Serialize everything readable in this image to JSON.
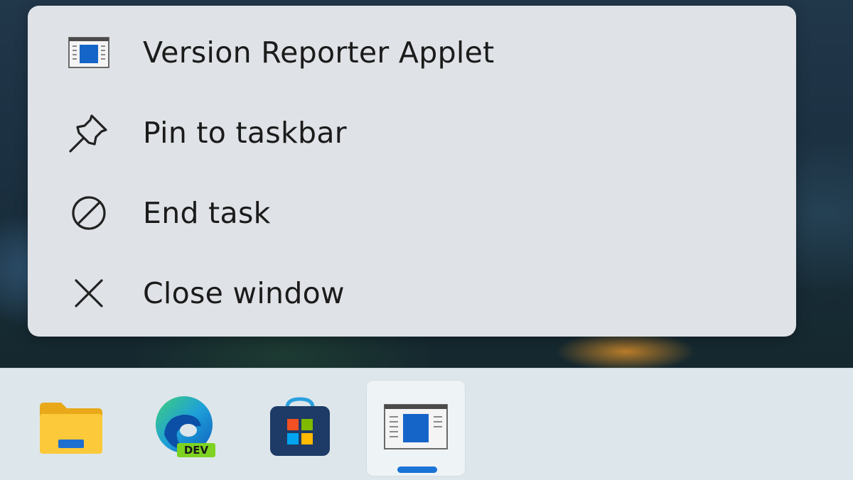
{
  "context_menu": {
    "items": [
      {
        "label": "Version Reporter Applet",
        "icon": "app-window-icon"
      },
      {
        "label": "Pin to taskbar",
        "icon": "pin-icon"
      },
      {
        "label": "End task",
        "icon": "prohibited-icon"
      },
      {
        "label": "Close window",
        "icon": "close-icon"
      }
    ]
  },
  "taskbar": {
    "apps": [
      {
        "name": "File Explorer",
        "icon": "folder-icon"
      },
      {
        "name": "Microsoft Edge Dev",
        "icon": "edge-dev-icon",
        "badge": "DEV"
      },
      {
        "name": "Microsoft Store",
        "icon": "store-icon"
      },
      {
        "name": "Version Reporter Applet",
        "icon": "app-window-icon",
        "active": true
      }
    ]
  },
  "colors": {
    "menu_background": "#dfe2e6",
    "accent": "#1a73d6",
    "taskbar_background": "#dde6ea"
  }
}
